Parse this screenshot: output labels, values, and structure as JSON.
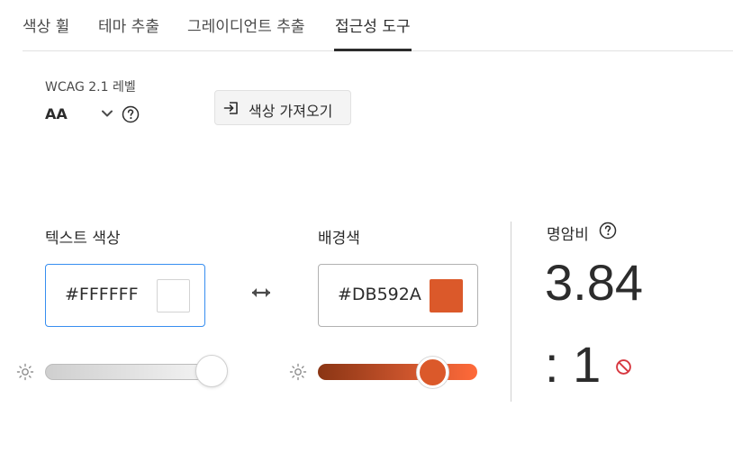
{
  "tabs": [
    {
      "label": "색상 휠"
    },
    {
      "label": "테마 추출"
    },
    {
      "label": "그레이디언트 추출"
    },
    {
      "label": "접근성 도구",
      "active": true
    }
  ],
  "wcag": {
    "label": "WCAG 2.1 레벨",
    "value": "AA"
  },
  "import_button": {
    "label": "색상 가져오기"
  },
  "text_color": {
    "label": "텍스트 색상",
    "hex": "#FFFFFF",
    "swatch": "#FFFFFF",
    "brightness": 1.0
  },
  "background_color": {
    "label": "배경색",
    "hex": "#DB592A",
    "swatch": "#DB592A",
    "brightness": 0.72
  },
  "contrast": {
    "label": "명암비",
    "value": "3.84",
    "suffix": ": 1",
    "passes": false
  },
  "colors": {
    "accent": "#2c2c2c",
    "border": "#b1b1b1",
    "fail": "#d7373f",
    "focus_border": "#378ef0"
  }
}
